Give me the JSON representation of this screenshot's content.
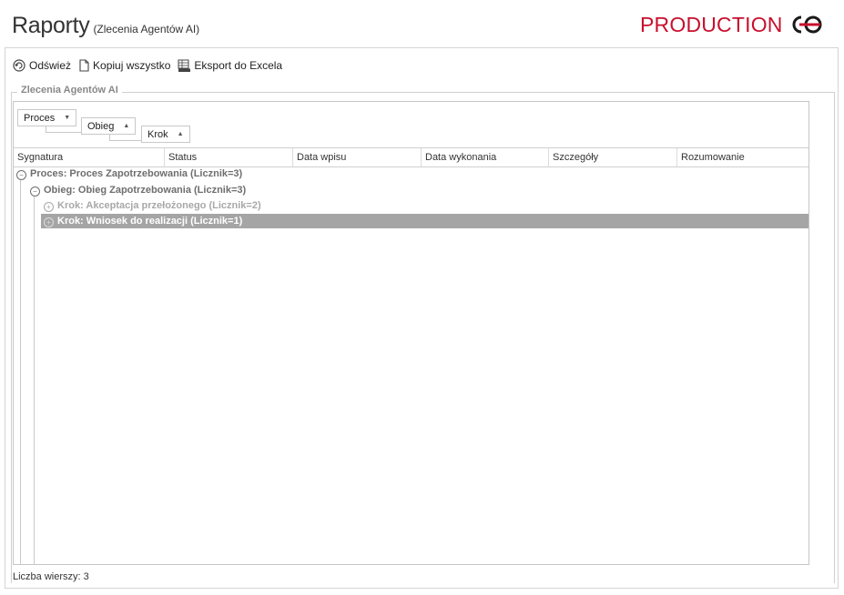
{
  "header": {
    "title": "Raporty",
    "subtitle": "(Zlecenia Agentów AI)",
    "environment": "PRODUCTION",
    "logo_icon": "brand-logo-icon",
    "env_color": "#c8102e"
  },
  "toolbar": {
    "refresh_label": "Odśwież",
    "copy_label": "Kopiuj wszystko",
    "export_label": "Eksport do Excela"
  },
  "groupbox": {
    "label": "Zlecenia Agentów AI"
  },
  "grouping": [
    "Proces",
    "Obieg",
    "Krok"
  ],
  "columns": [
    "Sygnatura",
    "Status",
    "Data wpisu",
    "Data wykonania",
    "Szczegóły",
    "Rozumowanie"
  ],
  "rows": [
    {
      "level": 0,
      "text": "Proces: Proces Zapotrzebowania  (Licznik=3)",
      "expanded": true
    },
    {
      "level": 1,
      "text": "Obieg: Obieg Zapotrzebowania (Licznik=3)",
      "expanded": true
    },
    {
      "level": 2,
      "text": "Krok: Akceptacja przełożonego (Licznik=2)",
      "expanded": false
    },
    {
      "level": 2,
      "text": "Krok: Wniosek do realizacji (Licznik=1)",
      "expanded": false,
      "selected": true
    }
  ],
  "footer": {
    "row_count": "Liczba wierszy: 3"
  },
  "colors": {
    "selected_row": "#a5a5a5",
    "level0_text": "#6e6e6e",
    "level1_text": "#6e6e6e",
    "level2_text": "#a8a8a8"
  }
}
